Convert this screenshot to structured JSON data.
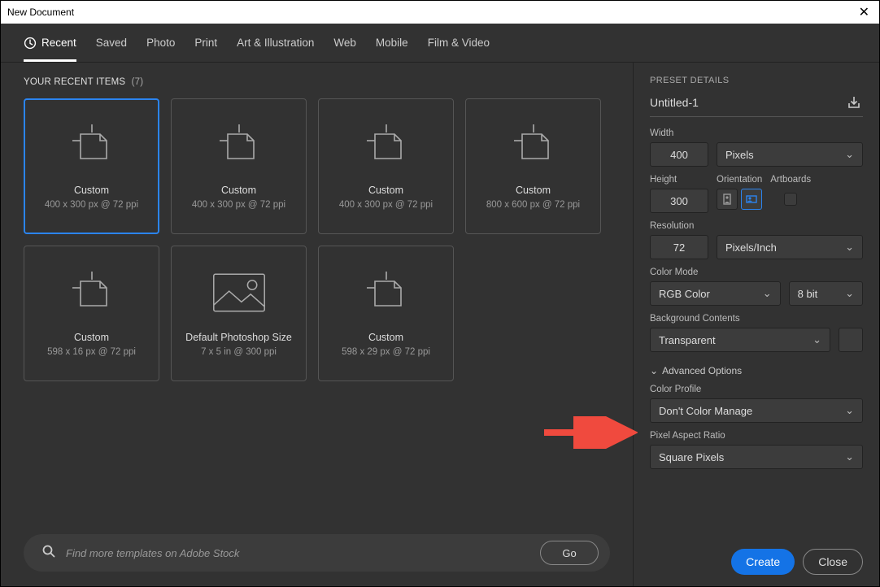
{
  "window": {
    "title": "New Document"
  },
  "tabs": {
    "items": [
      {
        "label": "Recent",
        "has_icon": true
      },
      {
        "label": "Saved"
      },
      {
        "label": "Photo"
      },
      {
        "label": "Print"
      },
      {
        "label": "Art & Illustration"
      },
      {
        "label": "Web"
      },
      {
        "label": "Mobile"
      },
      {
        "label": "Film & Video"
      }
    ],
    "active_index": 0
  },
  "section": {
    "heading": "YOUR RECENT ITEMS",
    "count": "(7)"
  },
  "cards": [
    {
      "name": "Custom",
      "sub": "400 x 300 px @ 72 ppi",
      "selected": true,
      "icon": "doc"
    },
    {
      "name": "Custom",
      "sub": "400 x 300 px @ 72 ppi",
      "icon": "doc"
    },
    {
      "name": "Custom",
      "sub": "400 x 300 px @ 72 ppi",
      "icon": "doc"
    },
    {
      "name": "Custom",
      "sub": "800 x 600 px @ 72 ppi",
      "icon": "doc"
    },
    {
      "name": "Custom",
      "sub": "598 x 16 px @ 72 ppi",
      "icon": "doc"
    },
    {
      "name": "Default Photoshop Size",
      "sub": "7 x 5 in @ 300 ppi",
      "icon": "img"
    },
    {
      "name": "Custom",
      "sub": "598 x 29 px @ 72 ppi",
      "icon": "doc"
    }
  ],
  "search": {
    "placeholder": "Find more templates on Adobe Stock",
    "go_label": "Go"
  },
  "panel": {
    "heading": "PRESET DETAILS",
    "name_value": "Untitled-1",
    "width": {
      "label": "Width",
      "value": "400",
      "unit": "Pixels"
    },
    "height": {
      "label": "Height",
      "value": "300"
    },
    "orientation_label": "Orientation",
    "artboards_label": "Artboards",
    "resolution": {
      "label": "Resolution",
      "value": "72",
      "unit": "Pixels/Inch"
    },
    "color_mode": {
      "label": "Color Mode",
      "value": "RGB Color",
      "depth": "8 bit"
    },
    "bg": {
      "label": "Background Contents",
      "value": "Transparent"
    },
    "advanced_label": "Advanced Options",
    "color_profile": {
      "label": "Color Profile",
      "value": "Don't Color Manage"
    },
    "aspect": {
      "label": "Pixel Aspect Ratio",
      "value": "Square Pixels"
    }
  },
  "footer": {
    "create": "Create",
    "close": "Close"
  }
}
